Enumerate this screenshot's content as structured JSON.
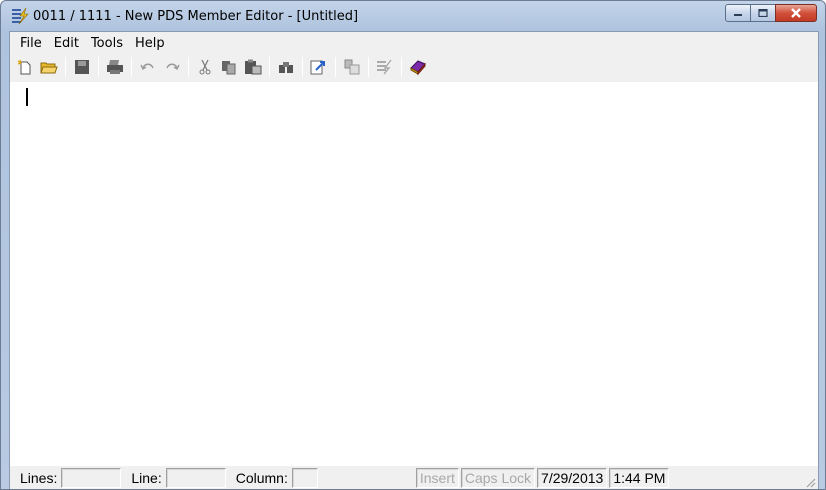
{
  "window": {
    "title": "0011 / 1111 - New PDS Member Editor - [Untitled]",
    "app_icon": "pds-editor-icon",
    "caption_buttons": [
      "minimize-icon",
      "maximize-icon",
      "close-icon"
    ]
  },
  "menubar": {
    "items": [
      "File",
      "Edit",
      "Tools",
      "Help"
    ]
  },
  "toolbar": {
    "buttons": [
      "new-icon",
      "open-folder-icon",
      "save-icon",
      "print-icon",
      "undo-icon",
      "redo-icon",
      "cut-icon",
      "copy-icon",
      "paste-icon",
      "find-icon",
      "export-icon",
      "submit-icon",
      "editor-icon",
      "book-icon"
    ]
  },
  "statusbar": {
    "lines_label": "Lines:",
    "lines_value": "",
    "line_label": "Line:",
    "line_value": "",
    "column_label": "Column:",
    "column_value": "",
    "insert": "Insert",
    "caps_lock": "Caps Lock",
    "date": "7/29/2013",
    "time": "1:44 PM"
  },
  "colors": {
    "title_bar": "#b8cbe3",
    "close_button": "#c94b36",
    "client_background": "#f0f0f0",
    "editor_background": "#ffffff"
  }
}
